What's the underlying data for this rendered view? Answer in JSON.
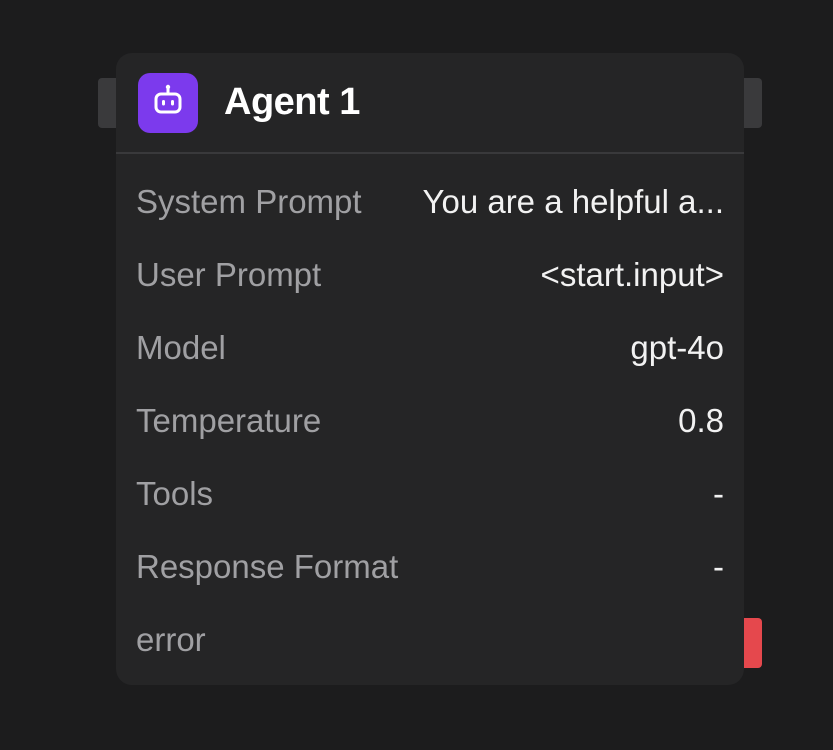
{
  "node": {
    "title": "Agent 1",
    "icon": "robot-icon",
    "icon_color": "#7c3aed",
    "rows": [
      {
        "label": "System Prompt",
        "value": "You are a helpful a..."
      },
      {
        "label": "User Prompt",
        "value": "<start.input>"
      },
      {
        "label": "Model",
        "value": "gpt-4o"
      },
      {
        "label": "Temperature",
        "value": "0.8"
      },
      {
        "label": "Tools",
        "value": "-"
      },
      {
        "label": "Response Format",
        "value": "-"
      },
      {
        "label": "error",
        "value": ""
      }
    ]
  },
  "colors": {
    "background": "#1c1c1d",
    "node_background": "#252526",
    "error_handle": "#e5484d"
  }
}
